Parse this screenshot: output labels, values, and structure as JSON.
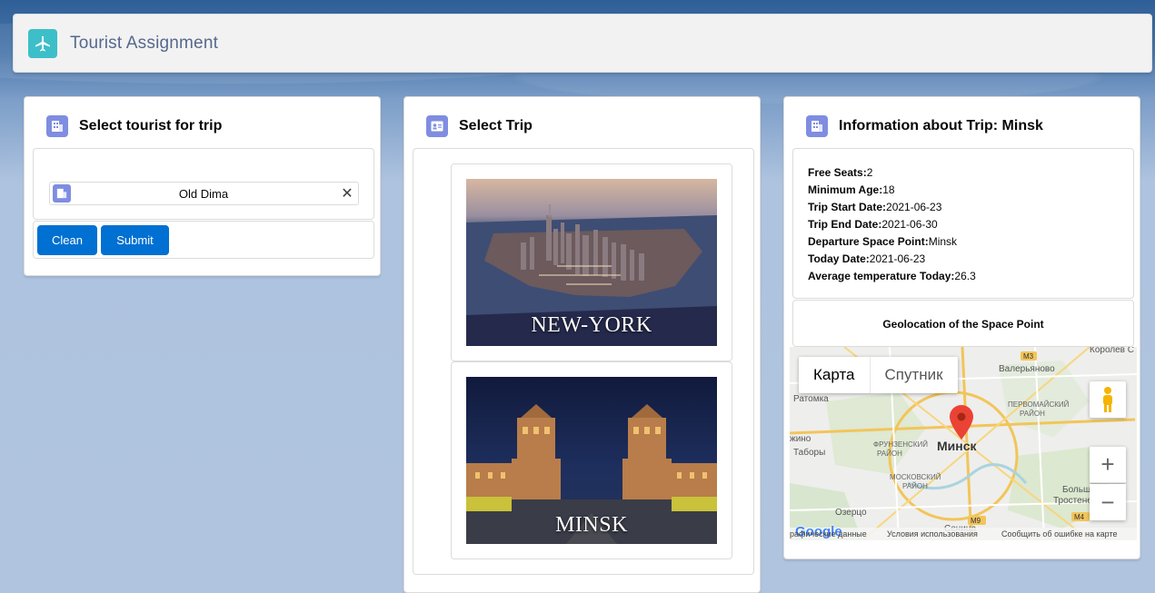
{
  "header": {
    "title": "Tourist Assignment",
    "icon": "airplane-icon"
  },
  "tourist_card": {
    "title": "Select tourist for trip",
    "selected_tourist": "Old Dima",
    "clean_label": "Clean",
    "submit_label": "Submit"
  },
  "trip_card": {
    "title": "Select Trip",
    "trips": [
      {
        "name": "NEW-YORK"
      },
      {
        "name": "MINSK"
      }
    ]
  },
  "info_card": {
    "title": "Information about Trip: Minsk",
    "fields": [
      {
        "label": "Free Seats:",
        "value": "2"
      },
      {
        "label": "Minimum Age:",
        "value": "18"
      },
      {
        "label": "Trip Start Date:",
        "value": "2021-06-23"
      },
      {
        "label": "Trip End Date:",
        "value": "2021-06-30"
      },
      {
        "label": "Departure Space Point:",
        "value": "Minsk"
      },
      {
        "label": "Today Date:",
        "value": "2021-06-23"
      },
      {
        "label": "Average temperature Today:",
        "value": "26.3"
      }
    ],
    "geo_title": "Geolocation of the Space Point",
    "map": {
      "type_map": "Карта",
      "type_satellite": "Спутник",
      "city": "Минск",
      "labels": {
        "valeryanovo": "Валерьяново",
        "korolev": "Королев С",
        "ratomka": "Ратомка",
        "pervomaysky": "ПЕРВОМАЙСКИЙ",
        "rayon1": "РАЙОН",
        "frunzensky": "ФРУНЗЕНСКИЙ",
        "rayon2": "РАЙОН",
        "moskovsky": "МОСКОВСКИЙ",
        "rayon3": "РАЙОН",
        "zhino": "жино",
        "tabory": "Таборы",
        "ozertso": "Озерцо",
        "bolshoy": "Большой",
        "trostenets": "Тростенец",
        "senitsa": "Сеница",
        "m3": "M3",
        "m9": "M9",
        "m4": "M4"
      },
      "zoom_in": "+",
      "zoom_out": "−",
      "footer_data": "рафические данные",
      "footer_terms": "Условия использования",
      "footer_report": "Сообщить об ошибке на карте",
      "google": "Google"
    }
  }
}
